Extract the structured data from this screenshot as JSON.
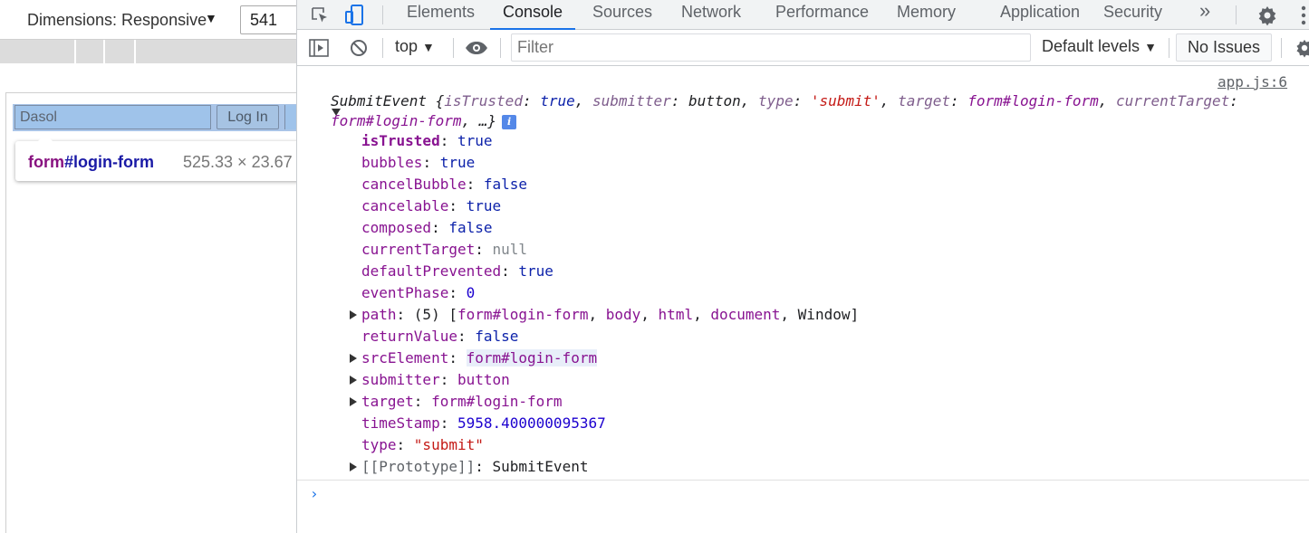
{
  "viewport": {
    "dimensions_label": "Dimensions: Responsive",
    "dimensions_caret": "▼",
    "width_value": "541",
    "username_value": "Dasol",
    "login_label": "Log In",
    "tooltip": {
      "tag": "form",
      "id": "#login-form",
      "size": "525.33 × 23.67"
    }
  },
  "devtools": {
    "tabs": [
      {
        "label": "Elements",
        "active": false
      },
      {
        "label": "Console",
        "active": true
      },
      {
        "label": "Sources",
        "active": false
      },
      {
        "label": "Network",
        "active": false
      },
      {
        "label": "Performance",
        "active": false
      },
      {
        "label": "Memory",
        "active": false
      },
      {
        "label": "Application",
        "active": false
      },
      {
        "label": "Security",
        "active": false
      }
    ],
    "more_tabs_glyph": "»",
    "toolbar": {
      "context": "top",
      "caret": "▼",
      "filter_placeholder": "Filter",
      "levels": "Default levels",
      "issues": "No Issues"
    }
  },
  "console": {
    "source": "app.js:6",
    "summary": {
      "class_name": "SubmitEvent",
      "open": "{",
      "isTrusted_key": "isTrusted",
      "isTrusted_val": "true",
      "submitter_key": "submitter",
      "submitter_val": "button",
      "type_key": "type",
      "type_val": "'submit'",
      "target_key": "target",
      "target_val": "form#login-form",
      "currentTarget_key": "currentTarget",
      "currentTarget_val": "form#login-form",
      "ellipsis": "…}",
      "info_glyph": "i"
    },
    "props": {
      "isTrusted": {
        "key": "isTrusted",
        "value": "true"
      },
      "bubbles": {
        "key": "bubbles",
        "value": "true"
      },
      "cancelBubble": {
        "key": "cancelBubble",
        "value": "false"
      },
      "cancelable": {
        "key": "cancelable",
        "value": "true"
      },
      "composed": {
        "key": "composed",
        "value": "false"
      },
      "currentTarget": {
        "key": "currentTarget",
        "value": "null"
      },
      "defaultPrevented": {
        "key": "defaultPrevented",
        "value": "true"
      },
      "eventPhase": {
        "key": "eventPhase",
        "value": "0"
      },
      "path": {
        "key": "path",
        "count": "(5)",
        "items": [
          "form#login-form",
          "body",
          "html",
          "document",
          "Window"
        ]
      },
      "returnValue": {
        "key": "returnValue",
        "value": "false"
      },
      "srcElement": {
        "key": "srcElement",
        "value": "form#login-form"
      },
      "submitter": {
        "key": "submitter",
        "value": "button"
      },
      "target": {
        "key": "target",
        "value": "form#login-form"
      },
      "timeStamp": {
        "key": "timeStamp",
        "value": "5958.400000095367"
      },
      "type": {
        "key": "type",
        "value": "\"submit\""
      },
      "prototype": {
        "key": "[[Prototype]]",
        "value": "SubmitEvent"
      }
    },
    "prompt_glyph": "›"
  },
  "colors": {
    "accent": "#1a73e8",
    "property_key": "#881391",
    "string_value": "#c41a16",
    "keyword_value": "#0d22aa",
    "number_value": "#1c00cf",
    "form_highlight": "#a9c4e7"
  },
  "icons": [
    "inspect-element-icon",
    "device-toolbar-icon",
    "more-tabs-icon",
    "settings-gear-icon",
    "kebab-menu-icon",
    "sidebar-toggle-icon",
    "clear-console-icon",
    "eye-icon",
    "info-icon"
  ]
}
